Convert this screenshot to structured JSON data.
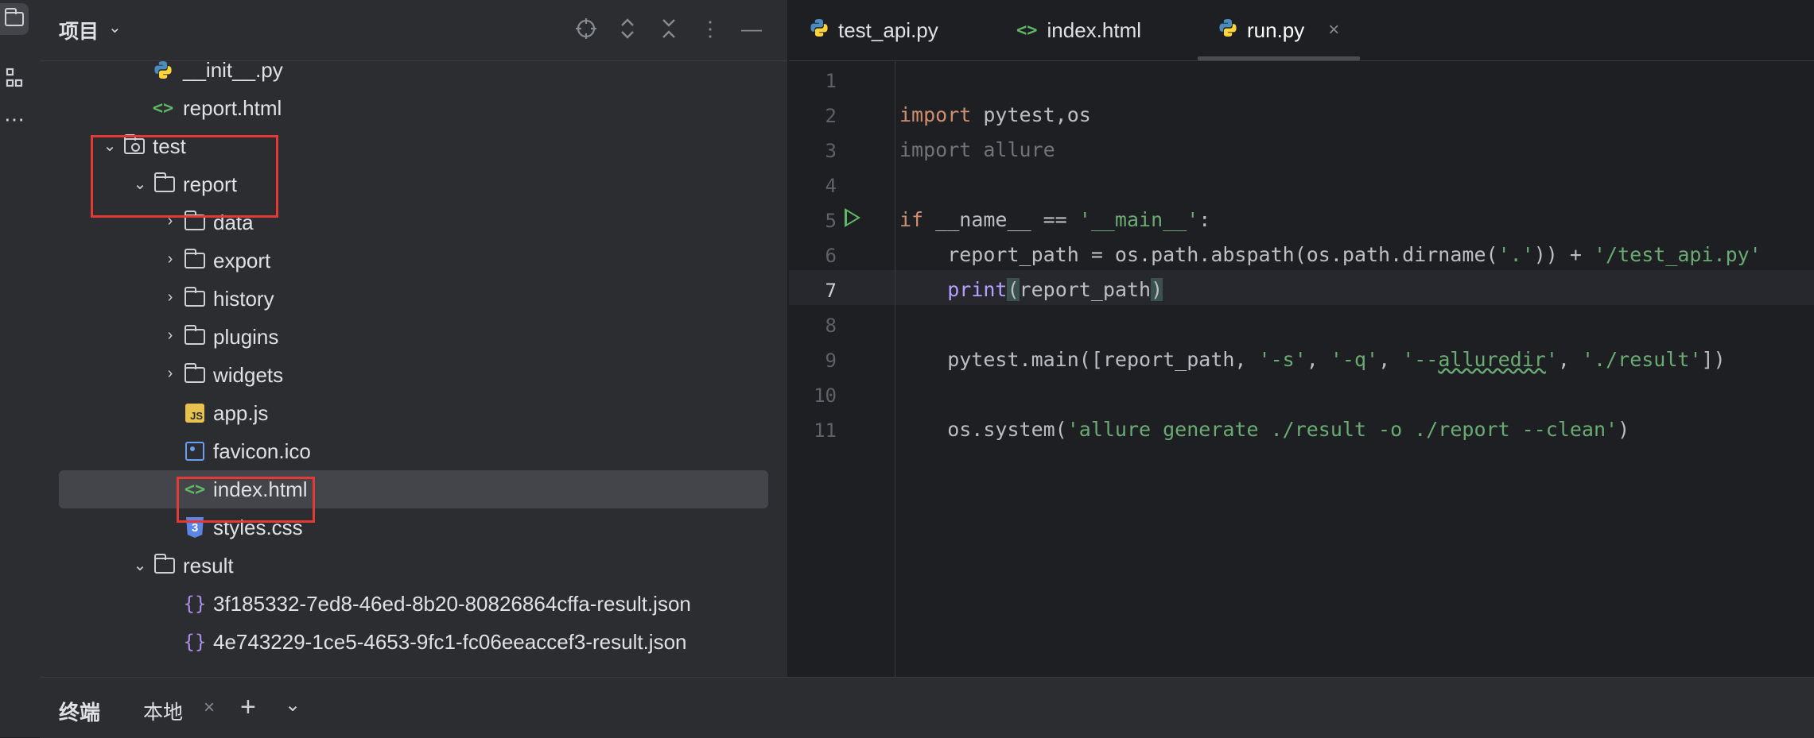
{
  "sidebar": {
    "title": "项目"
  },
  "tree": [
    {
      "label": "__init__.py",
      "icon": "python-icon"
    },
    {
      "label": "report.html",
      "icon": "html-icon"
    },
    {
      "label": "test",
      "icon": "module-folder-icon",
      "expanded": true
    },
    {
      "label": "report",
      "icon": "folder-icon",
      "expanded": true
    },
    {
      "label": "data",
      "icon": "folder-icon",
      "expanded": false
    },
    {
      "label": "export",
      "icon": "folder-icon",
      "expanded": false
    },
    {
      "label": "history",
      "icon": "folder-icon",
      "expanded": false
    },
    {
      "label": "plugins",
      "icon": "folder-icon",
      "expanded": false
    },
    {
      "label": "widgets",
      "icon": "folder-icon",
      "expanded": false
    },
    {
      "label": "app.js",
      "icon": "js-icon",
      "js_badge": "JS"
    },
    {
      "label": "favicon.ico",
      "icon": "image-icon"
    },
    {
      "label": "index.html",
      "icon": "html-icon",
      "selected": true
    },
    {
      "label": "styles.css",
      "icon": "css-icon"
    },
    {
      "label": "result",
      "icon": "folder-icon",
      "expanded": true
    },
    {
      "label": "3f185332-7ed8-46ed-8b20-80826864cffa-result.json",
      "icon": "json-icon"
    },
    {
      "label": "4e743229-1ce5-4653-9fc1-fc06eeaccef3-result.json",
      "icon": "json-icon"
    }
  ],
  "tabs": [
    {
      "label": "test_api.py",
      "icon": "python-icon"
    },
    {
      "label": "index.html",
      "icon": "html-icon"
    },
    {
      "label": "run.py",
      "icon": "python-icon",
      "active": true,
      "close": "×"
    }
  ],
  "editor": {
    "current_line": 7,
    "line_numbers": [
      "1",
      "2",
      "3",
      "4",
      "5",
      "6",
      "7",
      "8",
      "9",
      "10",
      "11"
    ],
    "code": {
      "l2_kw": "import",
      "l2_rest": " pytest,os",
      "l3": "import allure",
      "l5_kw": "if",
      "l5_mid": " __name__ == ",
      "l5_str": "'__main__'",
      "l5_end": ":",
      "l6_a": "    report_path = os.path.abspath(os.path.dirname(",
      "l6_s1": "'.'",
      "l6_b": ")) + ",
      "l6_s2": "'/test_api.py'",
      "l7_indent": "    ",
      "l7_fn": "print",
      "l7_open": "(",
      "l7_arg": "report_path",
      "l7_close": ")",
      "l9_a": "    pytest.main([report_path, ",
      "l9_s1": "'-s'",
      "l9_c1": ", ",
      "l9_s2": "'-q'",
      "l9_c2": ", ",
      "l9_s3a": "'--",
      "l9_s3b": "alluredir",
      "l9_s3c": "'",
      "l9_c3": ", ",
      "l9_s4": "'./result'",
      "l9_end": "])",
      "l11_a": "    os.system(",
      "l11_s": "'allure generate ./result -o ./report --clean'",
      "l11_end": ")"
    }
  },
  "bottom_panel": {
    "title": "终端",
    "tab": "本地",
    "close": "×",
    "add": "+",
    "more": "⌄"
  },
  "colors": {
    "highlight_box": "#e53935",
    "keyword": "#cf8e6d",
    "string": "#6aab73",
    "builtin": "#b6a0ff"
  }
}
